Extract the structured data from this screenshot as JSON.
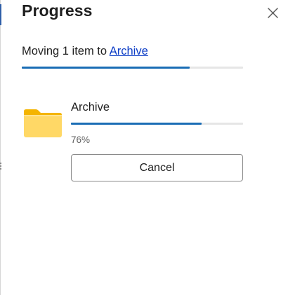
{
  "dialog": {
    "title": "Progress",
    "close_icon": "close-icon"
  },
  "operation": {
    "status_prefix": "Moving 1 item to",
    "destination_link": "Archive",
    "overall_progress": 0.76
  },
  "item": {
    "icon": "folder-icon",
    "name": "Archive",
    "progress": 0.76,
    "percent_text": "76%"
  },
  "actions": {
    "cancel_label": "Cancel"
  },
  "colors": {
    "accent": "#1a6db5",
    "link": "#0b3cc6",
    "track": "#e6e6e6",
    "folder_body": "#ffd866",
    "folder_tab": "#f4b400"
  }
}
